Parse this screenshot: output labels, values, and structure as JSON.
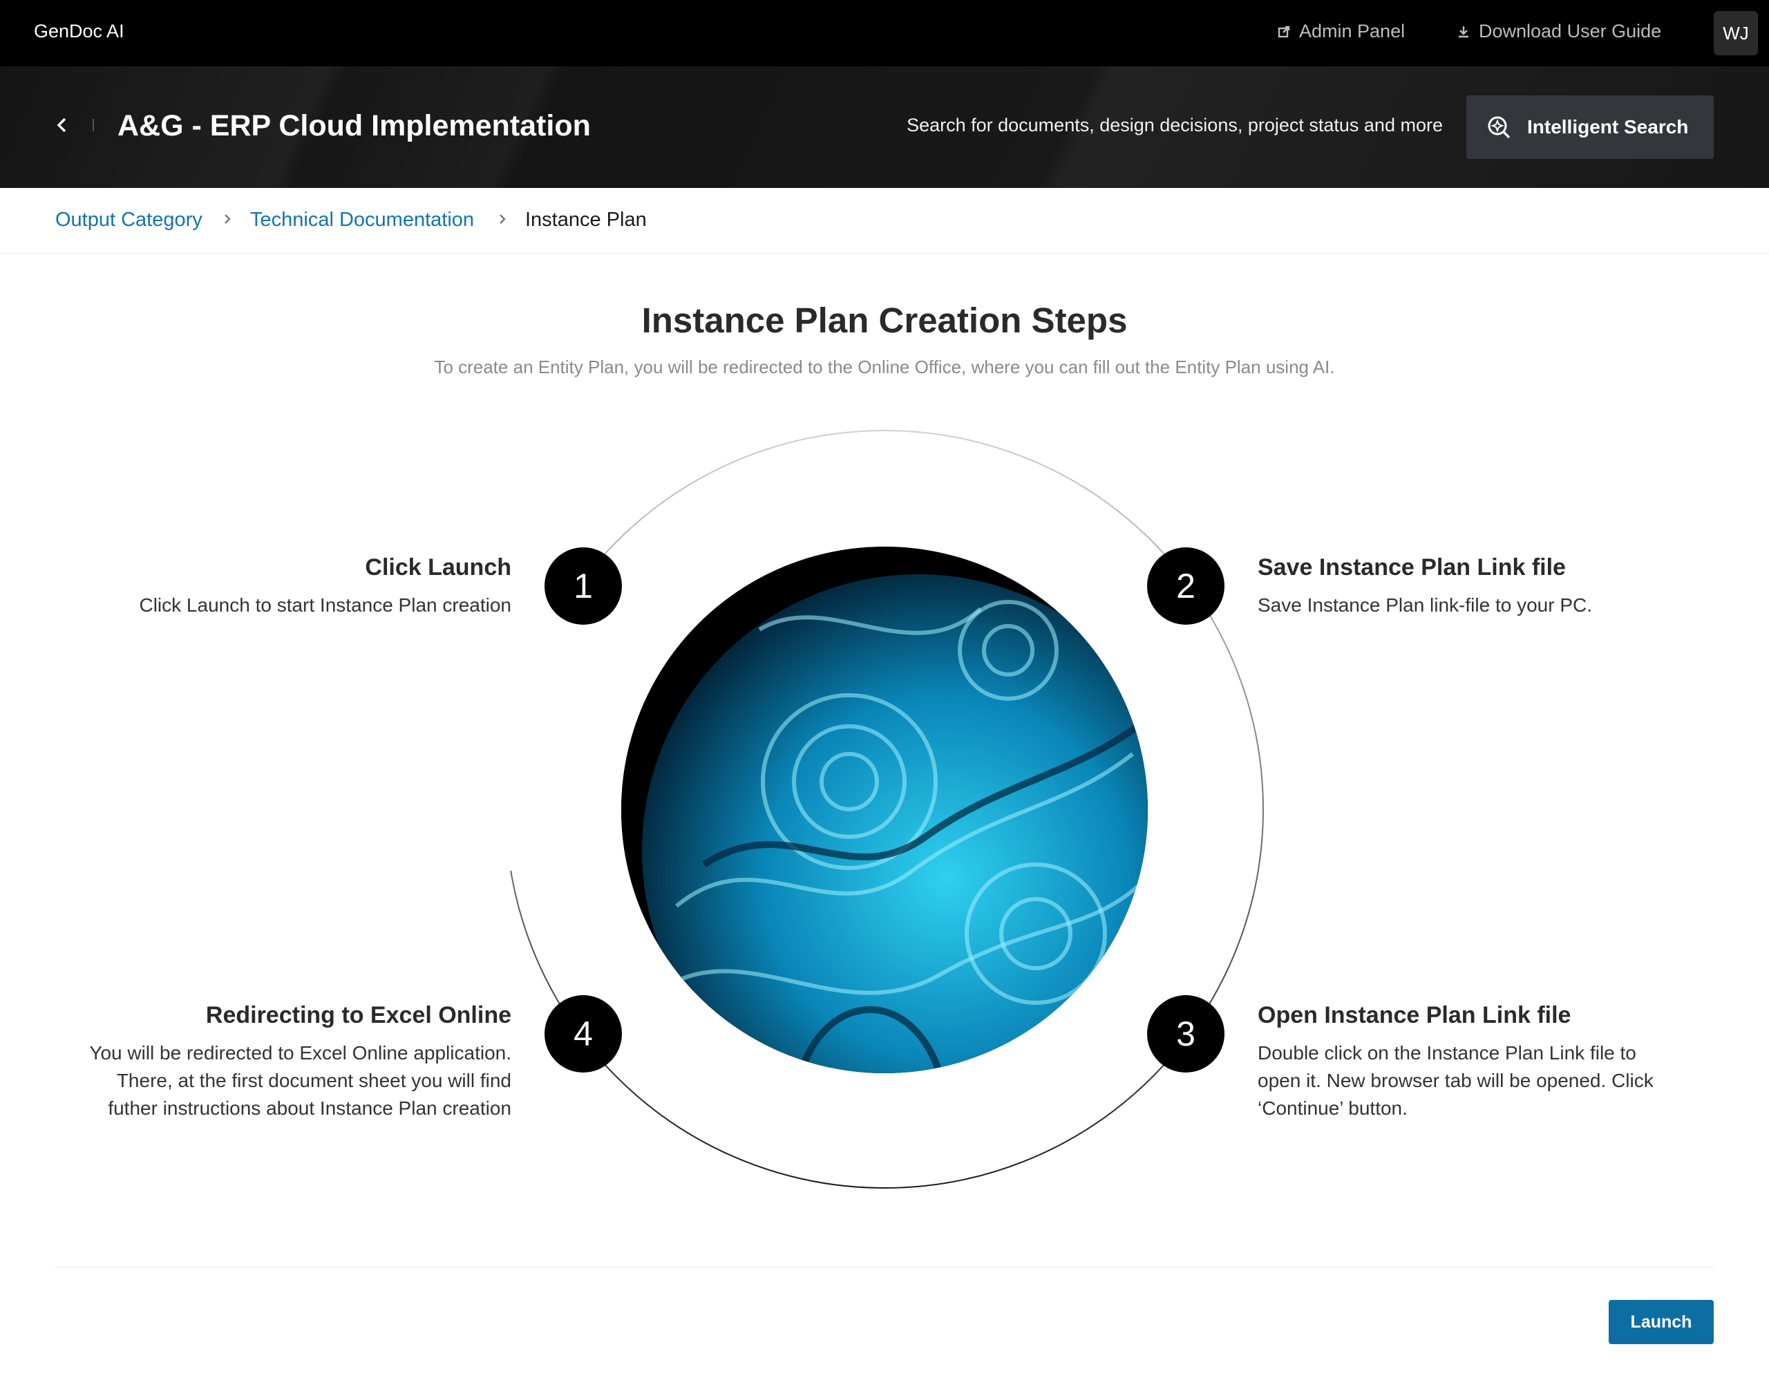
{
  "app": {
    "name": "GenDoc AI"
  },
  "topnav": {
    "admin_panel": "Admin Panel",
    "download_guide": "Download User Guide",
    "avatar_initials": "WJ"
  },
  "header": {
    "project_title": "A&G - ERP Cloud Implementation",
    "search_hint": "Search for documents, design decisions, project status and more",
    "search_button": "Intelligent Search"
  },
  "breadcrumb": {
    "items": [
      "Output Category",
      "Technical Documentation"
    ],
    "current": "Instance Plan"
  },
  "page": {
    "title": "Instance Plan Creation Steps",
    "subtitle": "To create an Entity Plan, you will be redirected to the Online Office, where you can fill out the Entity Plan using AI."
  },
  "steps": [
    {
      "number": "1",
      "title": "Click Launch",
      "text": [
        "Click Launch to start Instance Plan creation"
      ]
    },
    {
      "number": "2",
      "title": "Save Instance Plan Link file",
      "text": [
        "Save Instance Plan link-file to your PC."
      ]
    },
    {
      "number": "3",
      "title": "Open Instance Plan Link file",
      "text": [
        "Double click on the Instance Plan Link file to",
        "open it. New browser tab will be opened. Click",
        "‘Continue’ button."
      ]
    },
    {
      "number": "4",
      "title": "Redirecting to Excel Online",
      "text": [
        "You will be redirected to Excel Online application.",
        "There, at the first document sheet you will find",
        "futher instructions about Instance Plan creation"
      ]
    }
  ],
  "footer": {
    "launch_button": "Launch"
  },
  "colors": {
    "accent": "#0d6ea4",
    "link": "#1274b0",
    "topbar": "#000000",
    "orb": "#1fb8e0"
  }
}
